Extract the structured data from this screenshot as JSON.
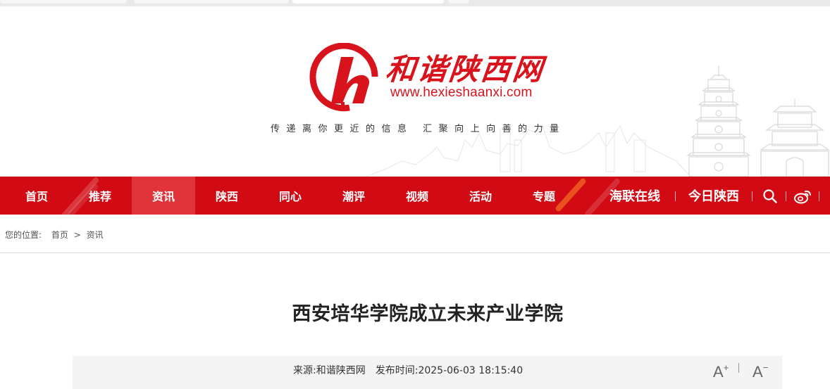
{
  "header": {
    "logo_cn": "和谐陕西网",
    "logo_url": "www.hexieshaanxi.com",
    "slogan": "传递离你更近的信息  汇聚向上向善的力量"
  },
  "nav": {
    "items": [
      "首页",
      "推荐",
      "资讯",
      "陕西",
      "同心",
      "潮评",
      "视频",
      "活动",
      "专题"
    ],
    "active": "资讯",
    "right": {
      "hailian": "海联在线",
      "today": "今日陕西"
    }
  },
  "breadcrumb": {
    "prefix": "您的位置:",
    "home": "首页",
    "sep": ">",
    "current": "资讯"
  },
  "article": {
    "title": "西安培华学院成立未来产业学院",
    "source_label": "来源:",
    "source": "和谐陕西网",
    "time_label": "发布时间:",
    "time": "2025-06-03 18:15:40",
    "font_larger": "A",
    "font_larger_sup": "+",
    "font_smaller": "A",
    "font_smaller_sup": "−"
  },
  "colors": {
    "brand_red": "#d10a14",
    "logo_red": "#d9131c",
    "active_nav": "#e0333a"
  }
}
